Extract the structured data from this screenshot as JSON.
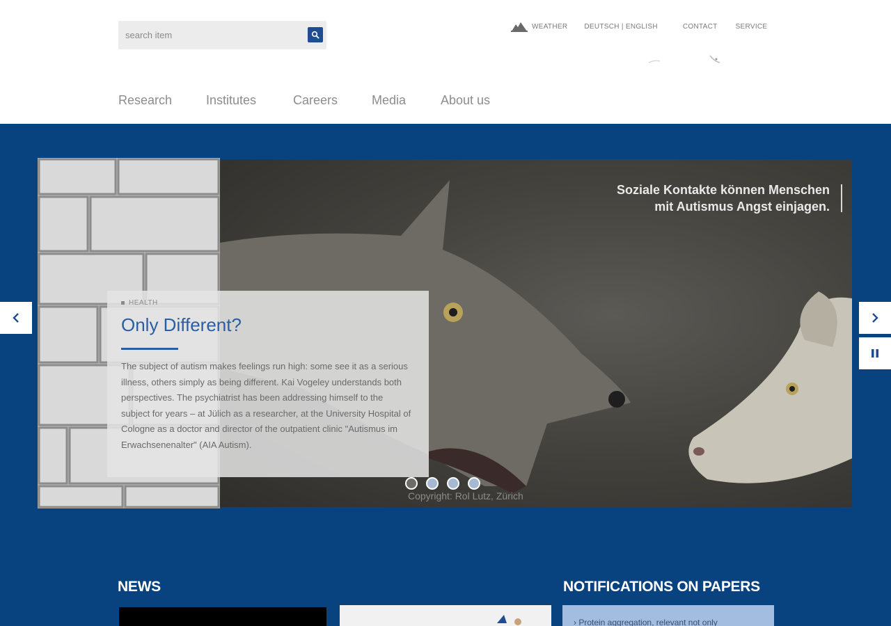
{
  "search": {
    "placeholder": "search item"
  },
  "top_links": {
    "weather": "WEATHER",
    "language": "DEUTSCH | ENGLISH",
    "contact": "CONTACT",
    "service": "SERVICE"
  },
  "nav": {
    "research": "Research",
    "institutes": "Institutes",
    "careers": "Careers",
    "media": "Media",
    "about": "About us"
  },
  "slider": {
    "quote": "Soziale Kontakte können Menschen\nmit Autismus Angst einjagen.",
    "category": "HEALTH",
    "title": "Only Different?",
    "text": "The subject of autism makes feelings run high: some see it as a serious illness, others simply as being different. Kai Vogeley understands both perspectives. The psychiatrist has been addressing himself to the subject for years – at Jülich as a researcher, at the University Hospital of Cologne as a doctor and director of the outpatient clinic \"Autismus im Erwachsenenalter\" (AIA Autism).",
    "copyright": "Copyright: Rol Lutz, Zürich",
    "slide_count": 4,
    "active_slide": 1
  },
  "sections": {
    "news": "NEWS",
    "notifications": "NOTIFICATIONS ON PAPERS",
    "first_notification": "› Protein aggregation, relevant not only"
  },
  "colors": {
    "brand_blue": "#08427f",
    "accent_blue": "#2a5ea3",
    "notification_bg": "#a3bde1"
  }
}
